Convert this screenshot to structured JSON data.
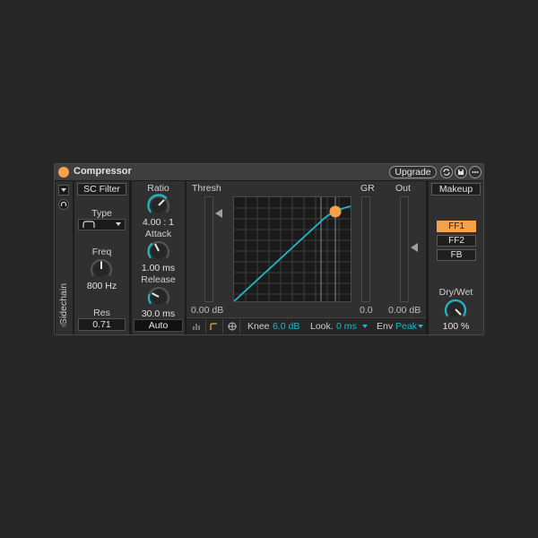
{
  "device": {
    "title": "Compressor",
    "upgrade_label": "Upgrade",
    "colors": {
      "accent": "#1fb6c6",
      "orange": "#f6a24b"
    }
  },
  "sidechain": {
    "label": "Sidechain",
    "filter_label": "SC Filter",
    "type_label": "Type",
    "freq_label": "Freq",
    "freq_value": "800 Hz",
    "res_label": "Res",
    "res_value": "0.71"
  },
  "dynamics": {
    "ratio_label": "Ratio",
    "ratio_value": "4.00 : 1",
    "attack_label": "Attack",
    "attack_value": "1.00 ms",
    "release_label": "Release",
    "release_value": "30.0 ms",
    "auto_label": "Auto"
  },
  "display": {
    "thresh_label": "Thresh",
    "thresh_value": "0.00 dB",
    "gr_label": "GR",
    "gr_value": "0.0",
    "out_label": "Out",
    "out_value": "0.00 dB",
    "knee_label": "Knee",
    "knee_value": "6.0 dB",
    "look_label": "Look.",
    "look_value": "0 ms",
    "env_label": "Env",
    "env_value": "Peak"
  },
  "output": {
    "makeup_label": "Makeup",
    "ff1_label": "FF1",
    "ff2_label": "FF2",
    "fb_label": "FB",
    "drywet_label": "Dry/Wet",
    "drywet_value": "100 %"
  }
}
